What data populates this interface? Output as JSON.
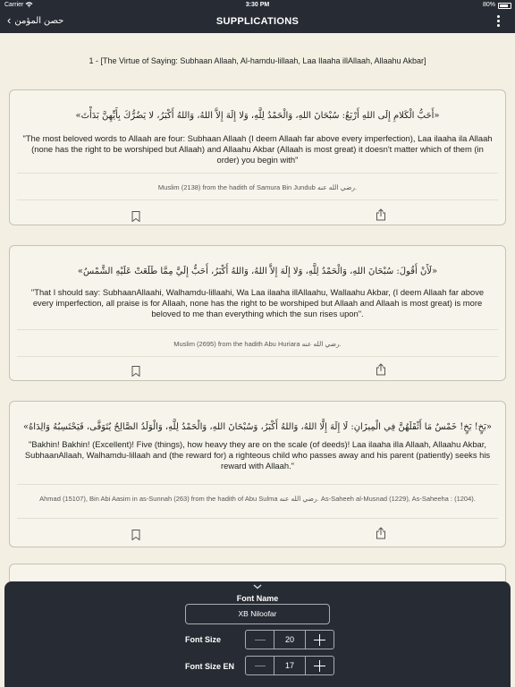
{
  "status_bar": {
    "carrier": "Carrier",
    "time": "3:30 PM",
    "battery": "80%"
  },
  "nav": {
    "back_label": "حصن المؤمن",
    "title": "SUPPLICATIONS"
  },
  "section_heading": "1 - [The Virtue of Saying: Subhaan Allaah, Al-hamdu-lillaah, Laa Ilaaha illAllaah, Allaahu Akbar]",
  "cards": [
    {
      "arabic": "«أَحَبُّ الْكَلامِ إِلَى اللهِ أَرْبَعٌ: سُبْحَانَ اللهِ، وَالْحَمْدُ لِلَّهِ، وَلا إِلَهَ إِلاَّ اللهُ، وَاللهُ أَكْبَرُ، لا يَضُرُّكَ بِأَيِّهِنَّ بَدَأْتَ»",
      "english": "\"The most beloved words to Allaah are four: Subhaan Allaah (I deem Allaah far above every imperfection), Laa ilaaha ila Allaah (none has the right to be worshiped but Allaah) and Allaahu Akbar (Allaah is most great) it doesn't matter which of them (in order) you begin with\"",
      "reference": "Muslim (2138) from the hadith of Samura Bin Jundub رضي الله عنه."
    },
    {
      "arabic": "«لَأَنْ أَقُولَ: سُبْحَانَ اللهِ، وَالْحَمْدُ لِلَّهِ، وَلا إِلَهَ إِلاَّ اللهُ، وَاللهُ أَكْبَرُ، أَحَبُّ إِلَيَّ مِمَّا طَلَعَتْ عَلَيْهِ الشَّمْسُ»",
      "english": "\"That I should say: SubhaanAllaahi, Walhamdu-lillaahi, Wa Laa ilaaha illAllaahu, Wallaahu Akbar, (I deem Allaah far above every imperfection, all praise is for Allaah, none has the right to be worshiped but Allaah and Allaah is most great) is more beloved to me than everything which the sun rises upon\".",
      "reference": "Muslim (2695) from the hadith Abu Huriara رضي الله عنه."
    },
    {
      "arabic": "«بَخٍ! بَخٍ! خَمْسٌ مَا أَثْقَلَهُنَّ فِي الْمِيزَانِ: لَا إِلَهَ إِلَّا اللهُ، وَاللهُ أَكْبَرُ، وَسُبْحَانَ اللهِ، وَالْحَمْدُ لِلَّهِ، وَالْوَلَدُ الصَّالِحُ يُتَوَفَّى، فَيَحْتَسِبُهُ وَالِدَاهُ»",
      "english": "\"Bakhin! Bakhin! (Excellent)!  Five (things), how heavy they are on the scale (of deeds)! Laa ilaaha illa Allaah, Allaahu Akbar, SubhaanAllaah, Walhamdu-lillaah and (the reward for) a righteous child who passes away and his parent (patiently) seeks his reward with Allaah.\"",
      "reference": "Ahmad (15107), Bin Abi Aasim in as-Sunnah (263) from the hadith of Abu Sulma رضي الله عنه. As-Saheeh al-Musnad (1229), As-Saheeha : (1204)."
    }
  ],
  "font_panel": {
    "font_name_label": "Font Name",
    "font_name_value": "XB Niloofar",
    "font_size_label": "Font Size",
    "font_size_value": "20",
    "font_size_en_label": "Font Size EN",
    "font_size_en_value": "17"
  },
  "icons": {
    "back": "chevron-left-icon",
    "more": "vertical-ellipsis-icon",
    "bookmark": "bookmark-icon",
    "share": "share-icon",
    "collapse": "chevron-down-icon"
  },
  "colors": {
    "bar_bg": "#272b33",
    "page_bg": "#f3f0e3",
    "card_bg": "#f7f5eb",
    "card_border": "#c4c2b6"
  }
}
